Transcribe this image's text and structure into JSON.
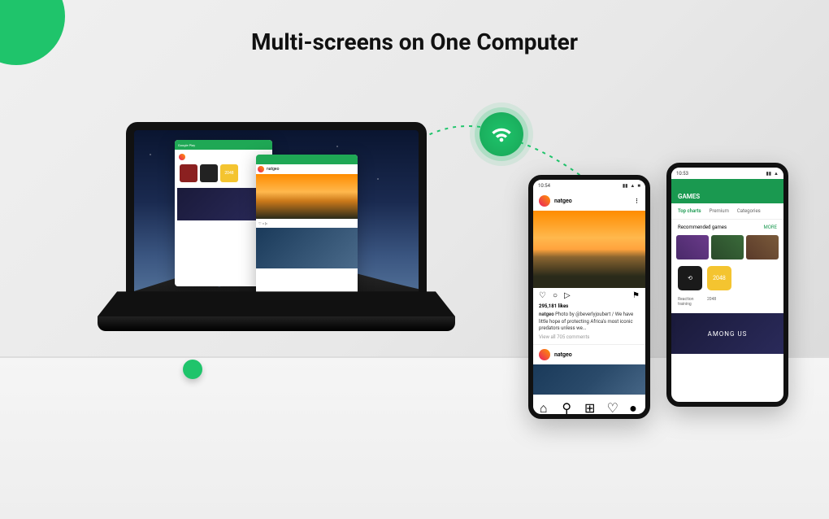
{
  "title": "Multi-screens on One Computer",
  "laptop": {
    "window_a": {
      "header": "Google Play",
      "tiles": [
        "",
        "",
        "2048"
      ]
    },
    "window_b": {
      "username": "natgeo"
    }
  },
  "phone_front": {
    "status_time": "10:54",
    "username": "natgeo",
    "likes": "295,181 likes",
    "caption_user": "natgeo",
    "caption_text": "Photo by @beverlyjoubert / We have little hope of protecting Africa's most iconic predators unless we...",
    "view_comments": "View all 705 comments",
    "second_user": "natgeo"
  },
  "phone_back": {
    "status_time": "10:53",
    "header": "GAMES",
    "tabs": [
      "Top charts",
      "Premium",
      "Categories"
    ],
    "section": "Recommended games",
    "more": "MORE",
    "app1_label": "Reaction training",
    "app2_label": "2048",
    "app2_icon": "2048",
    "banner": "AMONG US"
  },
  "icons": {
    "wifi": "wifi-icon",
    "heart": "♡",
    "comment": "○",
    "send": "▷",
    "bookmark": "⚑",
    "home": "⌂",
    "search": "⚲",
    "add": "⊞",
    "activity": "♡",
    "profile": "●"
  }
}
